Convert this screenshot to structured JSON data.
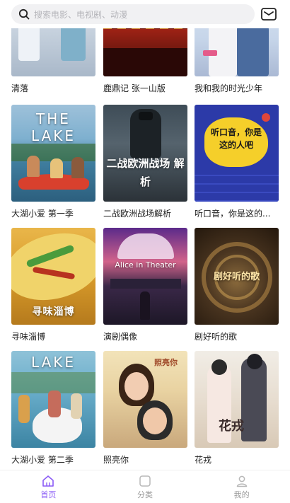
{
  "search": {
    "placeholder": "搜索电影、电视剧、动漫"
  },
  "icons": {
    "search": "search-icon",
    "mail": "mail-icon",
    "home": "home-icon",
    "category": "category-icon",
    "mine": "user-icon"
  },
  "colors": {
    "accent": "#8b5cf6",
    "inactive": "#9a9a9a"
  },
  "grid": {
    "items": [
      {
        "title": "清落"
      },
      {
        "title": "鹿鼎记 张一山版"
      },
      {
        "title": "我和我的时光少年"
      },
      {
        "title": "大湖小爱 第一季",
        "poster_text": "THE LAKE"
      },
      {
        "title": "二战欧洲战场解析",
        "poster_text": "二战欧洲战场 解析"
      },
      {
        "title": "听口音，你是这的...",
        "poster_text": "听口音，你是这的人吧"
      },
      {
        "title": "寻味淄博",
        "poster_text": "寻味淄博"
      },
      {
        "title": "演剧偶像",
        "poster_text": "Alice in Theater"
      },
      {
        "title": "剧好听的歌",
        "poster_text": "剧好听的歌"
      },
      {
        "title": "大湖小爱 第二季",
        "poster_text": "LAKE"
      },
      {
        "title": "照亮你",
        "poster_text": "照亮你"
      },
      {
        "title": "花戎",
        "poster_text": "花戎"
      }
    ]
  },
  "tabbar": {
    "items": [
      {
        "label": "首页"
      },
      {
        "label": "分类"
      },
      {
        "label": "我的"
      }
    ]
  }
}
